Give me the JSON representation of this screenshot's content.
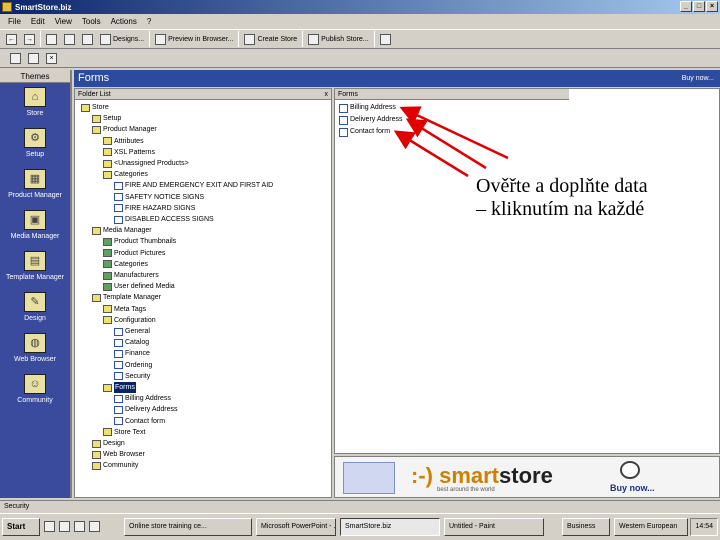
{
  "window": {
    "title": "SmartStore.biz"
  },
  "menubar": {
    "items": [
      "File",
      "Edit",
      "View",
      "Tools",
      "Actions",
      "?"
    ]
  },
  "toolbar": {
    "buttons": [
      "Designs...",
      "Preview in Browser...",
      "Create Store",
      "Publish Store..."
    ]
  },
  "sidebar": {
    "title": "Themes",
    "items": [
      "Store",
      "Setup",
      "Product Manager",
      "Media Manager",
      "Template Manager",
      "Design",
      "Web Browser",
      "Community"
    ]
  },
  "pane": {
    "title": "Forms",
    "buy_now": "Buy now..."
  },
  "folder_list": {
    "header": "Folder List",
    "close": "x",
    "tree": [
      {
        "label": "Store",
        "level": 0,
        "icon": "folder"
      },
      {
        "label": "Setup",
        "level": 1,
        "icon": "folder"
      },
      {
        "label": "Product Manager",
        "level": 1,
        "icon": "folder"
      },
      {
        "label": "Attributes",
        "level": 2,
        "icon": "folder"
      },
      {
        "label": "XSL Patterns",
        "level": 2,
        "icon": "folder"
      },
      {
        "label": "<Unassigned Products>",
        "level": 2,
        "icon": "folder"
      },
      {
        "label": "Categories",
        "level": 2,
        "icon": "folder"
      },
      {
        "label": "FIRE AND EMERGENCY EXIT AND FIRST AID",
        "level": 3,
        "icon": "doc"
      },
      {
        "label": "SAFETY NOTICE SIGNS",
        "level": 3,
        "icon": "doc"
      },
      {
        "label": "FIRE HAZARD SIGNS",
        "level": 3,
        "icon": "doc"
      },
      {
        "label": "DISABLED ACCESS SIGNS",
        "level": 3,
        "icon": "doc"
      },
      {
        "label": "Media Manager",
        "level": 1,
        "icon": "folder"
      },
      {
        "label": "Product Thumbnails",
        "level": 2,
        "icon": "img"
      },
      {
        "label": "Product Pictures",
        "level": 2,
        "icon": "img"
      },
      {
        "label": "Categories",
        "level": 2,
        "icon": "img"
      },
      {
        "label": "Manufacturers",
        "level": 2,
        "icon": "img"
      },
      {
        "label": "User defined Media",
        "level": 2,
        "icon": "img"
      },
      {
        "label": "Template Manager",
        "level": 1,
        "icon": "folder"
      },
      {
        "label": "Meta Tags",
        "level": 2,
        "icon": "folder"
      },
      {
        "label": "Configuration",
        "level": 2,
        "icon": "folder"
      },
      {
        "label": "General",
        "level": 3,
        "icon": "doc"
      },
      {
        "label": "Catalog",
        "level": 3,
        "icon": "doc"
      },
      {
        "label": "Finance",
        "level": 3,
        "icon": "doc"
      },
      {
        "label": "Ordering",
        "level": 3,
        "icon": "doc"
      },
      {
        "label": "Security",
        "level": 3,
        "icon": "doc"
      },
      {
        "label": "Forms",
        "level": 2,
        "icon": "folder",
        "selected": true
      },
      {
        "label": "Billing Address",
        "level": 3,
        "icon": "doc"
      },
      {
        "label": "Delivery Address",
        "level": 3,
        "icon": "doc"
      },
      {
        "label": "Contact form",
        "level": 3,
        "icon": "doc"
      },
      {
        "label": "Store Text",
        "level": 2,
        "icon": "folder"
      },
      {
        "label": "Design",
        "level": 1,
        "icon": "folder"
      },
      {
        "label": "Web Browser",
        "level": 1,
        "icon": "folder"
      },
      {
        "label": "Community",
        "level": 1,
        "icon": "folder"
      }
    ]
  },
  "forms_list": {
    "header": "Forms",
    "items": [
      "Billing Address",
      "Delivery Address",
      "Contact form"
    ]
  },
  "banner": {
    "logo_prefix": ":-) smart",
    "logo_suffix": "store",
    "tagline": "best around the world",
    "buy": "Buy now..."
  },
  "annotation": {
    "line1": "Ověřte a doplňte data",
    "line2": "– kliknutím na každé"
  },
  "statusbar": {
    "text": "Security"
  },
  "taskbar": {
    "start": "Start",
    "tasks": [
      "Online store training ce...",
      "Microsoft PowerPoint - ...",
      "SmartStore.biz",
      "Untitled - Paint",
      "Business",
      "Western European"
    ],
    "clock": "14:54"
  },
  "colors": {
    "accent": "#2c4a9e",
    "sidebar": "#3a4a9c",
    "annotation_arrow": "#e00000"
  }
}
